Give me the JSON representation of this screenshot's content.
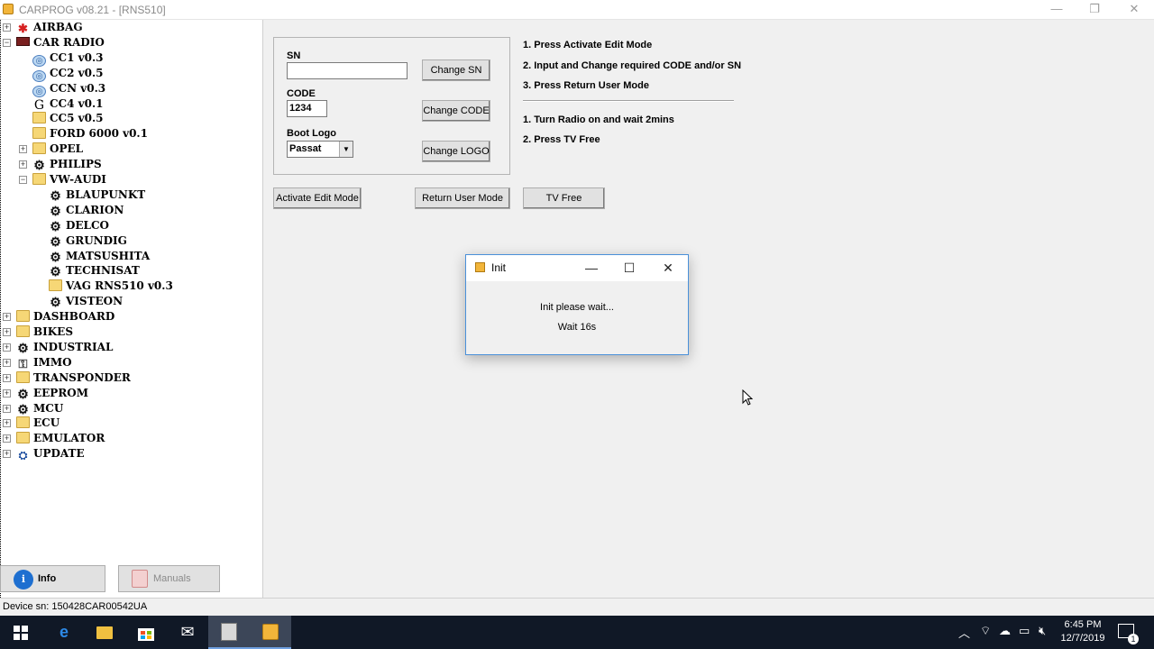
{
  "window": {
    "title": "CARPROG  v08.21 - [RNS510]"
  },
  "tree": {
    "nodes": [
      {
        "label": "AIRBAG",
        "icon": "airbag-icon"
      },
      {
        "label": "CAR RADIO",
        "icon": "car-radio-icon"
      },
      {
        "label": "CC1 v0.3",
        "icon": "globe-icon"
      },
      {
        "label": "CC2 v0.5",
        "icon": "globe-icon"
      },
      {
        "label": "CCN v0.3",
        "icon": "globe-icon"
      },
      {
        "label": "CC4 v0.1",
        "icon": "g-icon"
      },
      {
        "label": "CC5 v0.5",
        "icon": "folder-icon"
      },
      {
        "label": "FORD 6000 v0.1",
        "icon": "folder-icon"
      },
      {
        "label": "OPEL",
        "icon": "folder-icon"
      },
      {
        "label": "PHILIPS",
        "icon": "chip-icon"
      },
      {
        "label": "VW-AUDI",
        "icon": "folder-icon"
      },
      {
        "label": "BLAUPUNKT",
        "icon": "chip-icon"
      },
      {
        "label": "CLARION",
        "icon": "chip-icon"
      },
      {
        "label": "DELCO",
        "icon": "chip-icon"
      },
      {
        "label": "GRUNDIG",
        "icon": "chip-icon"
      },
      {
        "label": "MATSUSHITA",
        "icon": "chip-icon"
      },
      {
        "label": "TECHNISAT",
        "icon": "chip-icon"
      },
      {
        "label": "VAG RNS510 v0.3",
        "icon": "folder-icon"
      },
      {
        "label": "VISTEON",
        "icon": "chip-icon"
      },
      {
        "label": "DASHBOARD",
        "icon": "folder-icon"
      },
      {
        "label": "BIKES",
        "icon": "folder-icon"
      },
      {
        "label": "INDUSTRIAL",
        "icon": "chip-icon"
      },
      {
        "label": "IMMO",
        "icon": "immo-icon"
      },
      {
        "label": "TRANSPONDER",
        "icon": "folder-icon"
      },
      {
        "label": "EEPROM",
        "icon": "chip-icon"
      },
      {
        "label": "MCU",
        "icon": "chip-icon"
      },
      {
        "label": "ECU",
        "icon": "folder-icon"
      },
      {
        "label": "EMULATOR",
        "icon": "folder-icon"
      },
      {
        "label": "UPDATE",
        "icon": "update-icon"
      }
    ]
  },
  "bottom_buttons": {
    "info": "Info",
    "manuals": "Manuals"
  },
  "form": {
    "sn_label": "SN",
    "sn_value": "",
    "code_label": "CODE",
    "code_value": "1234",
    "boot_logo_label": "Boot Logo",
    "boot_logo_value": "Passat",
    "change_sn": "Change SN",
    "change_code": "Change CODE",
    "change_logo": "Change LOGO"
  },
  "instructions": {
    "step1": "1. Press Activate Edit Mode",
    "step2": "2. Input and Change required CODE and/or SN",
    "step3": "3. Press Return User Mode",
    "tv1": "1. Turn Radio on and wait 2mins",
    "tv2": "2. Press TV Free"
  },
  "actions": {
    "activate_edit": "Activate Edit Mode",
    "return_user": "Return User Mode",
    "tv_free": "TV Free"
  },
  "dialog": {
    "title": "Init",
    "message": "Init please wait...",
    "wait": "Wait 16s"
  },
  "status": {
    "device_sn": "Device sn: 150428CAR00542UA"
  },
  "taskbar": {
    "time": "6:45 PM",
    "date": "12/7/2019",
    "notifications_count": "1"
  }
}
